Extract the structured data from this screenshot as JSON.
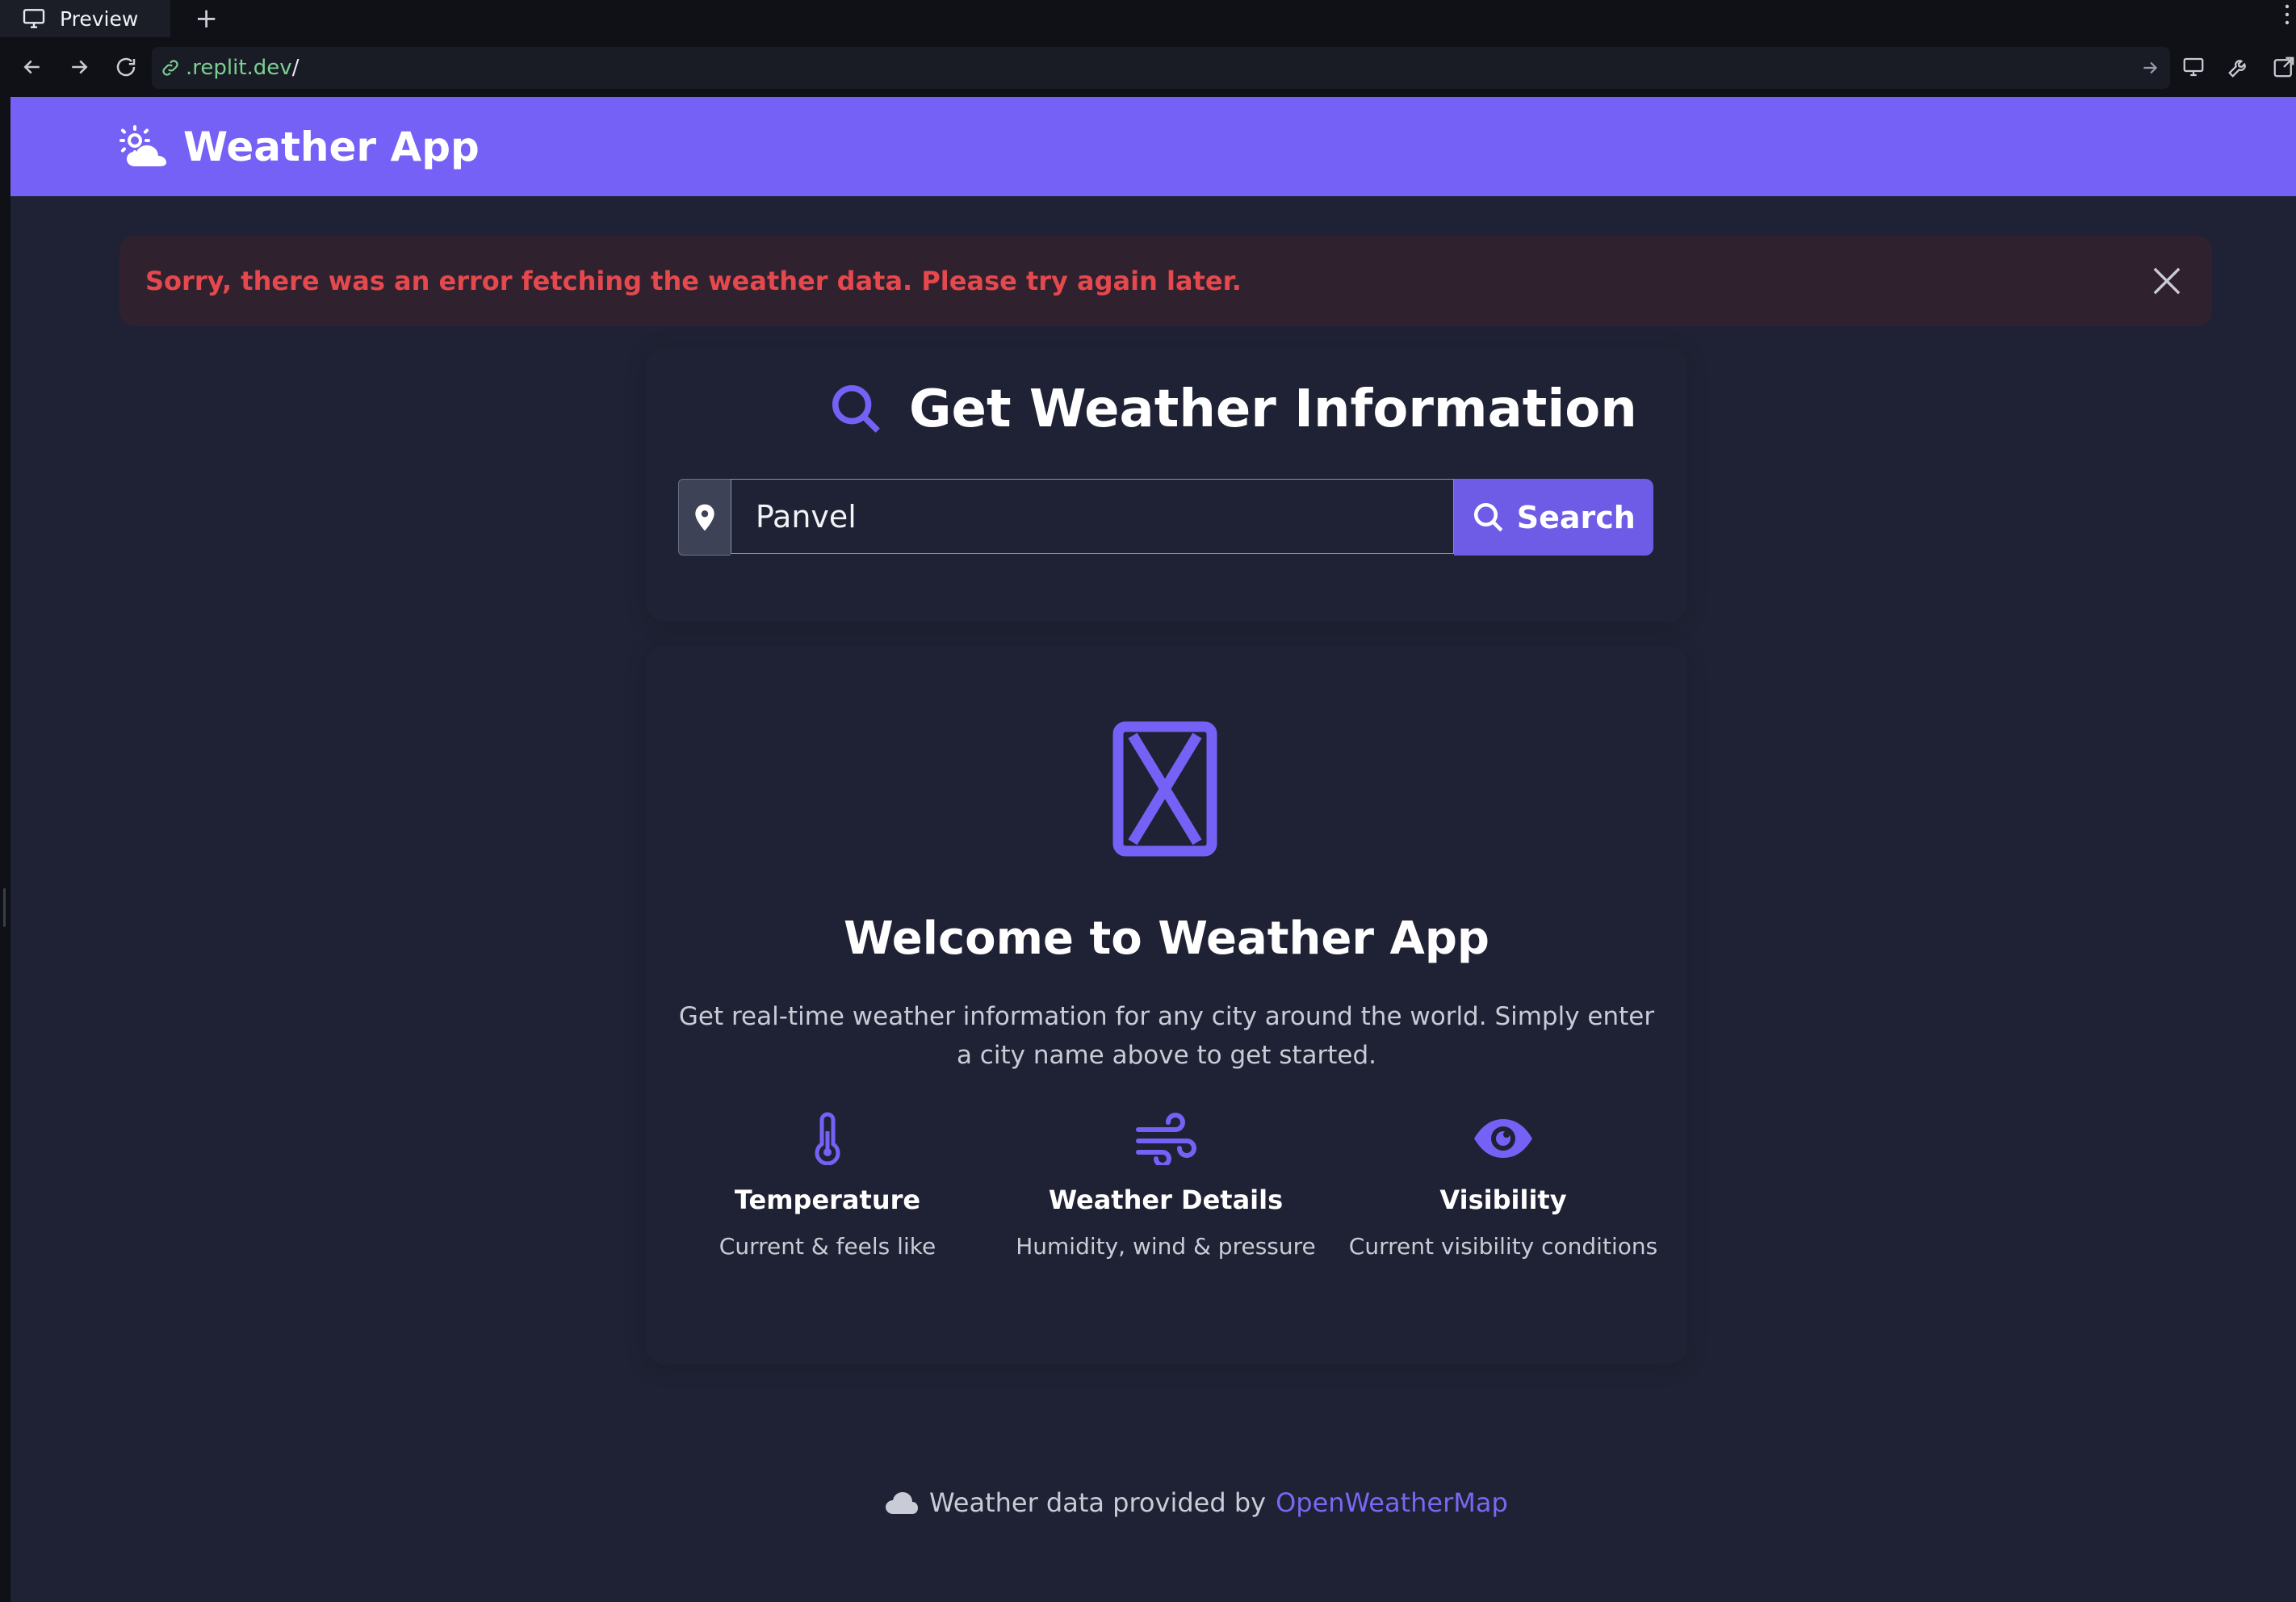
{
  "browser": {
    "tab_label": "Preview",
    "new_tab": "+",
    "url_host": ".replit.dev",
    "url_path": "/"
  },
  "header": {
    "title": "Weather App",
    "logo_icon": "sun-behind-cloud-icon"
  },
  "alert": {
    "message": "Sorry, there was an error fetching the weather data. Please try again later.",
    "close_icon": "close-icon"
  },
  "search": {
    "heading": "Get Weather Information",
    "heading_icon": "magnifier-icon",
    "input_value": "Panvel",
    "input_icon": "location-pin-icon",
    "button_label": "Search"
  },
  "welcome": {
    "icon": "hourglass-icon",
    "title": "Welcome to Weather App",
    "description": "Get real-time weather information for any city around the world. Simply enter a city name above to get started.",
    "features": [
      {
        "icon": "thermometer-icon",
        "title": "Temperature",
        "subtitle": "Current & feels like"
      },
      {
        "icon": "wind-icon",
        "title": "Weather Details",
        "subtitle": "Humidity, wind & pressure"
      },
      {
        "icon": "eye-icon",
        "title": "Visibility",
        "subtitle": "Current visibility conditions"
      }
    ]
  },
  "footer": {
    "text": "Weather data provided by",
    "link_label": "OpenWeatherMap",
    "icon": "cloud-icon"
  },
  "colors": {
    "accent": "#7561f5",
    "background": "#1f2234",
    "error_text": "#e5484d",
    "error_bg": "#30212f"
  }
}
